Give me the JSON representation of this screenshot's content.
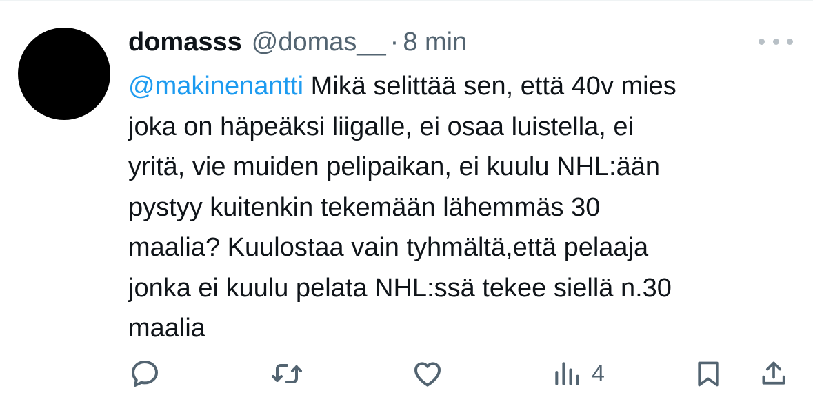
{
  "tweet": {
    "display_name": "domasss",
    "handle": "@domas__",
    "separator": "·",
    "time": "8 min",
    "mention": "@makinenantti",
    "text_lines": [
      " Mikä selittää sen, että 40v mies",
      "joka on häpeäksi liigalle, ei osaa luistella, ei",
      "yritä, vie muiden pelipaikan, ei kuulu NHL:ään",
      "pystyy kuitenkin tekemään lähemmäs 30",
      "maalia? Kuulostaa vain tyhmältä,että pelaaja",
      "jonka ei kuulu pelata NHL:ssä tekee siellä n.30",
      "maalia"
    ],
    "views_count": "4"
  },
  "icons": {
    "reply": "reply-icon",
    "retweet": "retweet-icon",
    "like": "like-icon",
    "views": "views-icon",
    "bookmark": "bookmark-icon",
    "share": "share-icon",
    "more": "more-options-icon"
  },
  "colors": {
    "text": "#0f1419",
    "secondary": "#536471",
    "mention": "#1d9bf0",
    "avatar": "#000000"
  }
}
